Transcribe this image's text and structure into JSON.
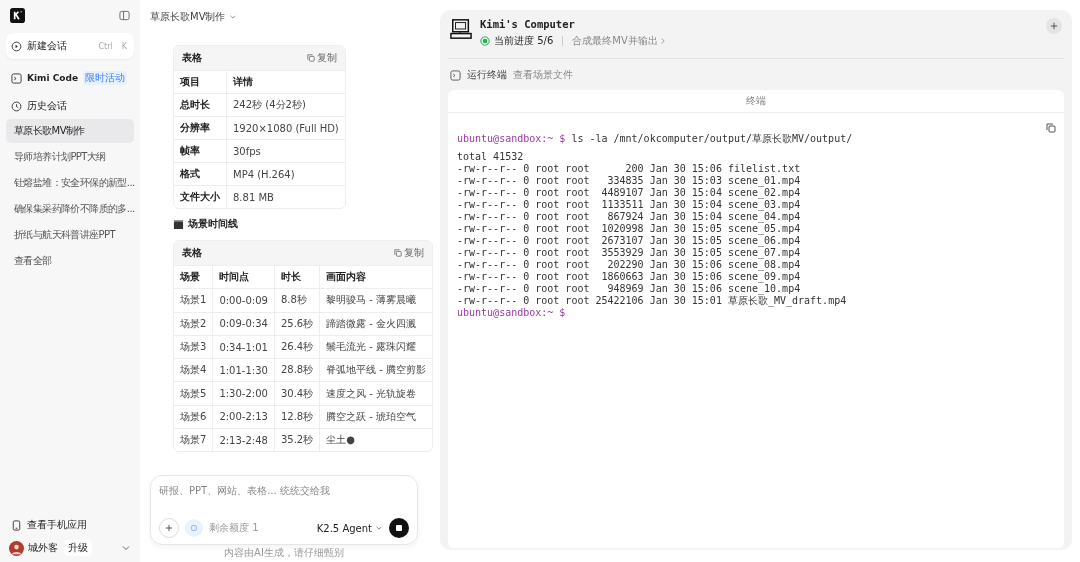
{
  "sidebar": {
    "new_chat": {
      "label": "新建会话",
      "shortcut": [
        "Ctrl",
        "K"
      ]
    },
    "kimi_code": {
      "label": "Kimi Code",
      "badge": "限时活动"
    },
    "history": {
      "label": "历史会话",
      "items": [
        {
          "label": "草原长歌MV制作",
          "selected": true
        },
        {
          "label": "导师培养计划PPT大纲",
          "selected": false
        },
        {
          "label": "钍熔盐堆：安全环保的新型...",
          "selected": false
        },
        {
          "label": "确保集采药降价不降质的多...",
          "selected": false
        },
        {
          "label": "折纸与航天科普讲座PPT",
          "selected": false
        }
      ],
      "view_all": "查看全部"
    },
    "mobile_app": "查看手机应用",
    "user": {
      "name": "城外客",
      "upgrade": "升级"
    }
  },
  "chat": {
    "title": "草原长歌MV制作",
    "table1": {
      "header": "表格",
      "copy": "复制",
      "columns": [
        "项目",
        "详情"
      ],
      "rows": [
        [
          "总时长",
          "242秒 (4分2秒)"
        ],
        [
          "分辨率",
          "1920×1080 (Full HD)"
        ],
        [
          "帧率",
          "30fps"
        ],
        [
          "格式",
          "MP4 (H.264)"
        ],
        [
          "文件大小",
          "8.81 MB"
        ]
      ]
    },
    "section_title": "场景时间线",
    "table2": {
      "header": "表格",
      "copy": "复制",
      "columns": [
        "场景",
        "时间点",
        "时长",
        "画面内容"
      ],
      "rows": [
        [
          "场景1",
          "0:00-0:09",
          "8.8秒",
          "黎明骏马 - 薄雾晨曦"
        ],
        [
          "场景2",
          "0:09-0:34",
          "25.6秒",
          "蹄踏微露 - 金火四溅"
        ],
        [
          "场景3",
          "0:34-1:01",
          "26.4秒",
          "鬃毛流光 - 露珠闪耀"
        ],
        [
          "场景4",
          "1:01-1:30",
          "28.8秒",
          "脊弧地平线 - 腾空剪影"
        ],
        [
          "场景5",
          "1:30-2:00",
          "30.4秒",
          "速度之风 - 光轨旋卷"
        ],
        [
          "场景6",
          "2:00-2:13",
          "12.8秒",
          "腾空之跃 - 琥珀空气"
        ],
        [
          "场景7",
          "2:13-2:48",
          "35.2秒",
          "尘土●"
        ]
      ]
    },
    "input": {
      "placeholder": "研报、PPT、网站、表格... 统统交给我",
      "quota": "剩余额度 1",
      "model": "K2.5 Agent"
    },
    "disclaimer": "内容由AI生成，请仔细甄别"
  },
  "computer": {
    "title": "Kimi's Computer",
    "progress": "当前进度 5/6",
    "step": "合成最终MV并输出",
    "tabs": [
      {
        "label": "运行终端",
        "selected": true
      },
      {
        "label": "查看场景文件",
        "selected": false
      }
    ],
    "terminal": {
      "title": "终端",
      "lines": [
        {
          "kind": "prompt",
          "prompt": "ubuntu@sandbox:~ $",
          "text": "ls -la /mnt/okcomputer/output/草原长歌MV/output/"
        },
        {
          "kind": "output",
          "text": "total 41532"
        },
        {
          "kind": "output",
          "text": "-rw-r--r-- 0 root root      200 Jan 30 15:06 filelist.txt"
        },
        {
          "kind": "output",
          "text": "-rw-r--r-- 0 root root   334835 Jan 30 15:03 scene_01.mp4"
        },
        {
          "kind": "output",
          "text": "-rw-r--r-- 0 root root  4489107 Jan 30 15:04 scene_02.mp4"
        },
        {
          "kind": "output",
          "text": "-rw-r--r-- 0 root root  1133511 Jan 30 15:04 scene_03.mp4"
        },
        {
          "kind": "output",
          "text": "-rw-r--r-- 0 root root   867924 Jan 30 15:04 scene_04.mp4"
        },
        {
          "kind": "output",
          "text": "-rw-r--r-- 0 root root  1020998 Jan 30 15:05 scene_05.mp4"
        },
        {
          "kind": "output",
          "text": "-rw-r--r-- 0 root root  2673107 Jan 30 15:05 scene_06.mp4"
        },
        {
          "kind": "output",
          "text": "-rw-r--r-- 0 root root  3553929 Jan 30 15:05 scene_07.mp4"
        },
        {
          "kind": "output",
          "text": "-rw-r--r-- 0 root root   202290 Jan 30 15:06 scene_08.mp4"
        },
        {
          "kind": "output",
          "text": "-rw-r--r-- 0 root root  1860663 Jan 30 15:06 scene_09.mp4"
        },
        {
          "kind": "output",
          "text": "-rw-r--r-- 0 root root   948969 Jan 30 15:06 scene_10.mp4"
        },
        {
          "kind": "output",
          "text": "-rw-r--r-- 0 root root 25422106 Jan 30 15:01 草原长歌_MV_draft.mp4"
        },
        {
          "kind": "prompt",
          "prompt": "ubuntu@sandbox:~ $"
        }
      ]
    }
  }
}
